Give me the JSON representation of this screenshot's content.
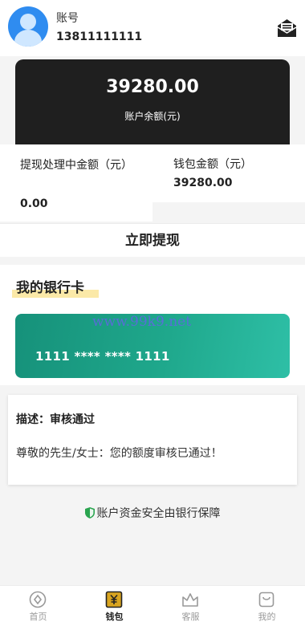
{
  "header": {
    "account_label": "账号",
    "account_number": "13811111111"
  },
  "balance": {
    "amount": "39280.00",
    "label": "账户余额(元)"
  },
  "stats": {
    "pending": {
      "label": "提现处理中金额（元）",
      "value": "0.00"
    },
    "wallet": {
      "label": "钱包金额（元）",
      "value": "39280.00"
    }
  },
  "withdraw_button": "立即提现",
  "bank_cards": {
    "title": "我的银行卡",
    "card_number": "1111 **** **** 1111",
    "watermark": "www.99k9.net"
  },
  "notice": {
    "title": "描述：审核通过",
    "body": "尊敬的先生/女士：您的额度审核已通过！"
  },
  "security_text": "账户资金安全由银行保障",
  "tabs": [
    {
      "label": "首页",
      "icon": "home-icon",
      "active": false
    },
    {
      "label": "钱包",
      "icon": "wallet-icon",
      "active": true
    },
    {
      "label": "客服",
      "icon": "service-icon",
      "active": false
    },
    {
      "label": "我的",
      "icon": "profile-icon",
      "active": false
    }
  ],
  "colors": {
    "balance_card": "#1f1f1f",
    "bank_card": "#1fa88c",
    "title_highlight": "#fbe9a8",
    "shield": "#2aa44f"
  }
}
